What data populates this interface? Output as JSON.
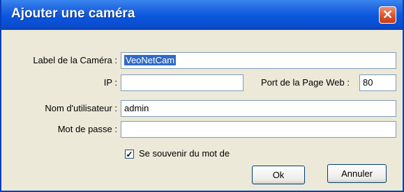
{
  "window": {
    "title": "Ajouter une caméra",
    "close_glyph": "✕"
  },
  "form": {
    "camera_label": {
      "label": "Label de la Caméra :",
      "value": "VeoNetCam"
    },
    "ip": {
      "label": "IP :",
      "value": ""
    },
    "port": {
      "label": "Port de la Page Web :",
      "value": "80"
    },
    "username": {
      "label": "Nom d'utilisateur :",
      "value": "admin"
    },
    "password": {
      "label": "Mot de passe :",
      "value": ""
    },
    "remember": {
      "label": "Se souvenir du mot de",
      "checked": true,
      "check_glyph": "✓"
    }
  },
  "buttons": {
    "ok": "Ok",
    "cancel": "Annuler"
  },
  "colors": {
    "titlebar": "#0a56dc",
    "dialog_bg": "#ece9d8",
    "selection": "#316ac5",
    "close_button": "#d8502a"
  }
}
